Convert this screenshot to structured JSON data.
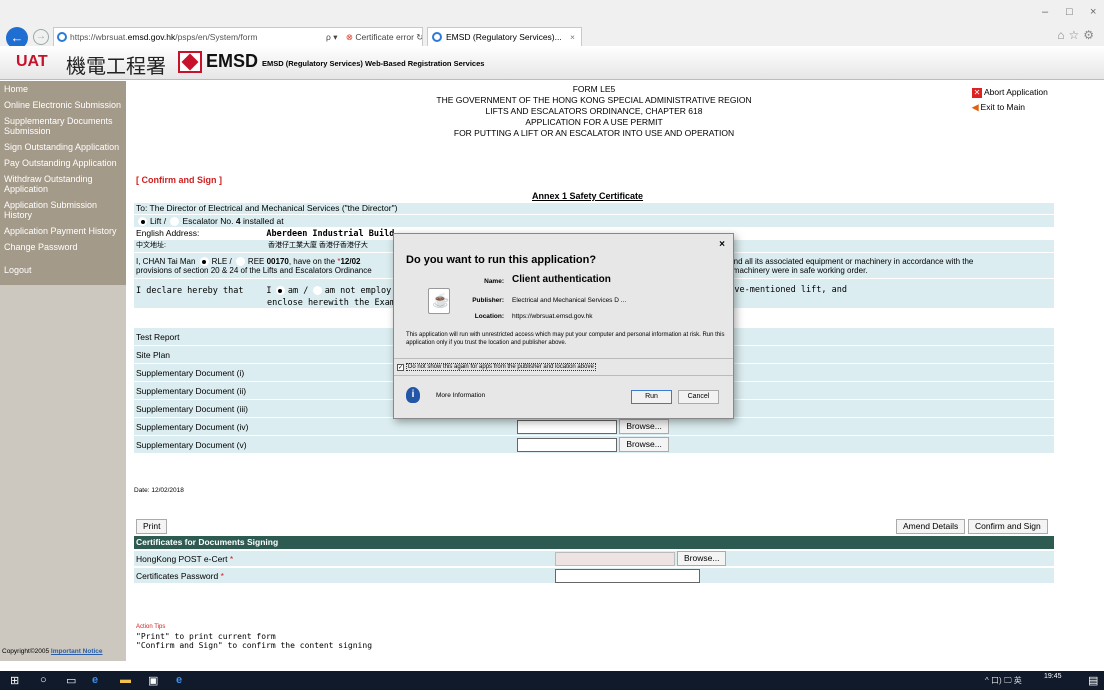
{
  "browser": {
    "url_prefix": "https://wbrsuat.",
    "url_host": "emsd.gov.hk",
    "url_path": "/psps/en/System/form",
    "search_glyph": "ρ ▾",
    "cert_error": "Certificate error",
    "refresh_glyph": "↻",
    "tab_title": "EMSD (Regulatory Services)...",
    "win_controls": [
      "–",
      "□",
      "×"
    ]
  },
  "header": {
    "env": "UAT",
    "dept_cn": "機電工程署",
    "dept_en": "EMSD",
    "title": "EMSD (Regulatory Services) Web-Based Registration Services"
  },
  "sidebar": {
    "items": [
      "Home",
      "Online Electronic Submission",
      "Supplementary Documents Submission",
      "Sign Outstanding Application",
      "Pay Outstanding Application",
      "Withdraw Outstanding Application",
      "Application Submission History",
      "Application Payment History",
      "Change Password",
      "Logout"
    ],
    "copyright_text": "Copyright©2005",
    "important_notice": "Important Notice"
  },
  "form": {
    "code": "FORM LE5",
    "line1": "THE GOVERNMENT OF THE HONG KONG SPECIAL ADMINISTRATIVE REGION",
    "line2": "LIFTS AND ESCALATORS ORDINANCE, CHAPTER 618",
    "line3": "APPLICATION FOR A USE PERMIT",
    "line4": "FOR PUTTING A LIFT OR AN ESCALATOR INTO USE AND OPERATION",
    "abort": "Abort Application",
    "exit": "Exit to Main",
    "section": "[ Confirm and Sign ]",
    "annex": "Annex 1 Safety Certificate",
    "to": "To: The Director of Electrical and Mechanical Services (\"the Director\")",
    "lift_label": "Lift /",
    "escalator_label": "Escalator No.",
    "equip_no": "4",
    "installed_at": "installed at",
    "english_address_label": "English Address:",
    "english_address": "Aberdeen Industrial Build",
    "chinese_address_label": "中文地址:",
    "chinese_address": "香港仔工業大廈 香港仔香港仔大",
    "declare_prefix": "I, CHAN Tai Man",
    "rle": "RLE /",
    "ree": "REE",
    "ree_no": "00170",
    "have_on": ", have on the",
    "star": "*",
    "date_frag": "12/02",
    "provisions": "provisions of section 20 & 24 of the Lifts and Escalators Ordinance",
    "right_frag1": "lift and all its associated equipment or machinery in accordance with the",
    "right_frag2": "t or machinery were in safe working order.",
    "declare_label": "I declare hereby that",
    "declare_i": "I",
    "am": "am /",
    "am_not": "am not employ",
    "enclose": "enclose herewith the Examin",
    "above": "above-mentioned lift, and",
    "docs": [
      "Test Report",
      "Site Plan",
      "Supplementary Document (i)",
      "Supplementary Document (ii)",
      "Supplementary Document (iii)",
      "Supplementary Document (iv)",
      "Supplementary Document (v)"
    ],
    "browse": "Browse...",
    "date": "Date: 12/02/2018",
    "print": "Print",
    "amend": "Amend Details",
    "confirm_sign": "Confirm and Sign",
    "cert_header": "Certificates for Documents Signing",
    "ecert_label": "HongKong POST e-Cert",
    "password_label": "Certificates Password",
    "required_mark": "*",
    "tips_title": "Action Tips",
    "tip1": "\"Print\" to print current form",
    "tip2": "\"Confirm and Sign\" to confirm the content signing"
  },
  "dialog": {
    "question": "Do you want to run this application?",
    "name_label": "Name:",
    "name": "Client authentication",
    "publisher_label": "Publisher:",
    "publisher": "Electrical and Mechanical Services D ...",
    "location_label": "Location:",
    "location": "https://wbrsuat.emsd.gov.hk",
    "warning": "This application will run with unrestricted access which may put your computer and personal information at risk. Run this application only if you trust the location and publisher above.",
    "checkbox_label": "Do not show this again for apps from the publisher and location above",
    "more_info": "More Information",
    "run": "Run",
    "cancel": "Cancel",
    "close": "×"
  },
  "taskbar": {
    "time": "19:45",
    "tray": "^ 口) 🖵 英"
  }
}
